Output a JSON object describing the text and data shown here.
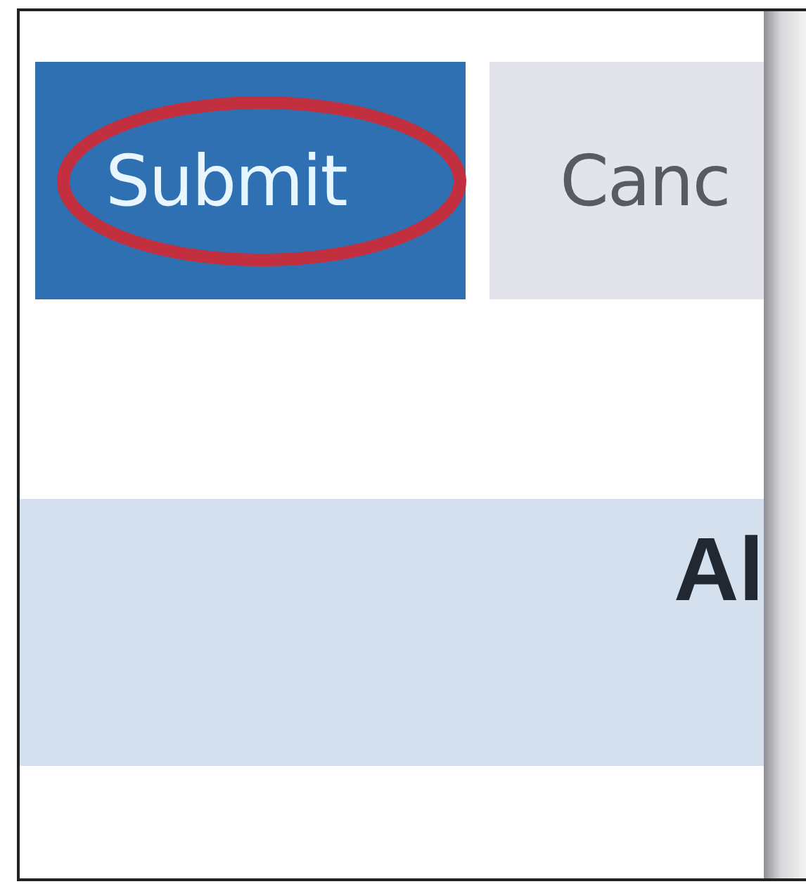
{
  "buttons": [
    {
      "label": "Submit",
      "kind": "primary",
      "highlighted": true
    },
    {
      "label": "Canc",
      "kind": "secondary",
      "highlighted": false
    }
  ],
  "header_band": {
    "label": "Al"
  }
}
